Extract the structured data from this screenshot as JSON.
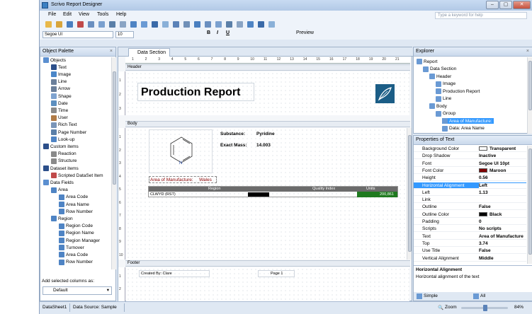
{
  "window": {
    "title": "Scrivo Report Designer"
  },
  "menu": [
    "File",
    "Edit",
    "View",
    "Tools",
    "Help"
  ],
  "help_placeholder": "Type a keyword for help",
  "toolbar": {
    "font": "Segoe UI",
    "size": "10",
    "bold": "B",
    "italic": "I",
    "underline": "U",
    "preview": "Preview"
  },
  "palette": {
    "title": "Object Palette",
    "items": [
      {
        "label": "Objects",
        "icon": "objects-icon",
        "color": "#5b8fd0"
      },
      {
        "label": "Text",
        "icon": "text-icon",
        "color": "#2c4f8a"
      },
      {
        "label": "Image",
        "icon": "image-icon",
        "color": "#4a86c8"
      },
      {
        "label": "Line",
        "icon": "line-icon",
        "color": "#6a7f9a"
      },
      {
        "label": "Arrow",
        "icon": "arrow-icon",
        "color": "#6a7f9a"
      },
      {
        "label": "Shape",
        "icon": "shape-icon",
        "color": "#7fa3cf"
      },
      {
        "label": "Date",
        "icon": "date-icon",
        "color": "#5c8fbf"
      },
      {
        "label": "Time",
        "icon": "time-icon",
        "color": "#8a8a8a"
      },
      {
        "label": "User",
        "icon": "user-icon",
        "color": "#b07b46"
      },
      {
        "label": "Rich Text",
        "icon": "rich-text-icon",
        "color": "#7a95b8"
      },
      {
        "label": "Page Number",
        "icon": "page-number-icon",
        "color": "#5a7fa8"
      },
      {
        "label": "Look-up",
        "icon": "lookup-icon",
        "color": "#4f84c4"
      },
      {
        "label": "Custom items",
        "icon": "custom-items-icon",
        "color": "#2c4f8a"
      },
      {
        "label": "Reaction",
        "icon": "reaction-icon",
        "color": "#8a8a8a"
      },
      {
        "label": "Structure",
        "icon": "structure-icon",
        "color": "#8a8a8a"
      },
      {
        "label": "Dataset items",
        "icon": "dataset-items-icon",
        "color": "#2c4f8a"
      },
      {
        "label": "Scripted DataSet Item",
        "icon": "scripted-dataset-icon",
        "color": "#c04a4a"
      },
      {
        "label": "Data Fields",
        "icon": "data-fields-icon",
        "color": "#5b8fd0"
      },
      {
        "label": "Area",
        "icon": "table-icon",
        "color": "#4f84c4"
      },
      {
        "label": "Area Code",
        "icon": "field-icon",
        "color": "#4f84c4"
      },
      {
        "label": "Area Name",
        "icon": "field-icon",
        "color": "#4f84c4"
      },
      {
        "label": "Row Number",
        "icon": "field-icon",
        "color": "#4f84c4"
      },
      {
        "label": "Region",
        "icon": "table-icon",
        "color": "#4f84c4"
      },
      {
        "label": "Region Code",
        "icon": "field-icon",
        "color": "#4f84c4"
      },
      {
        "label": "Region Name",
        "icon": "field-icon",
        "color": "#4f84c4"
      },
      {
        "label": "Region Manager",
        "icon": "field-icon",
        "color": "#4f84c4"
      },
      {
        "label": "Turnover",
        "icon": "field-icon",
        "color": "#4f84c4"
      },
      {
        "label": "Area Code",
        "icon": "field-icon",
        "color": "#4f84c4"
      },
      {
        "label": "Row Number",
        "icon": "field-icon",
        "color": "#4f84c4"
      }
    ],
    "columns_label": "Add selected columns as:",
    "columns_value": "Default"
  },
  "designer": {
    "tab": "Data Section",
    "header_label": "Header",
    "body_label": "Body",
    "footer_label": "Footer",
    "title": "Production Report",
    "substance_label": "Substance:",
    "substance_value": "Pyridine",
    "mass_label": "Exact Mass:",
    "mass_value": "14.003",
    "atom_label": "N",
    "area_label": "Area of Manufacture:",
    "area_value": "Wales",
    "table_headers": [
      "Region",
      "Quality Index",
      "Units"
    ],
    "table_row": {
      "region": "CLWYD (RST)",
      "units": "200,861"
    },
    "footer_left": "Created By: Clare",
    "footer_right": "Page 1",
    "ruler_top": [
      "1",
      "2",
      "3",
      "4",
      "5",
      "6",
      "7",
      "8",
      "9",
      "10",
      "11",
      "12",
      "13",
      "14",
      "15",
      "16",
      "17",
      "18",
      "19",
      "20",
      "21"
    ],
    "ruler_header": [
      "1",
      "2",
      "3"
    ],
    "ruler_body": [
      "1",
      "2",
      "3",
      "4",
      "5",
      "6",
      "7",
      "8",
      "9",
      "10"
    ],
    "ruler_footer": [
      "1",
      "2"
    ]
  },
  "explorer": {
    "title": "Explorer",
    "items": [
      "Report",
      "Data Section",
      "Header",
      "Image",
      "Production Report",
      "Line",
      "Body",
      "Group",
      "Area of Manufacture:",
      "Data: Area Name"
    ]
  },
  "properties": {
    "title": "Properties of Text",
    "rows": [
      {
        "k": "Background Color",
        "v": "Transparent",
        "sw": "#ffffff"
      },
      {
        "k": "Drop Shadow",
        "v": "Inactive"
      },
      {
        "k": "Font",
        "v": "Segoe UI 10pt"
      },
      {
        "k": "Font Color",
        "v": "Maroon",
        "sw": "#800000"
      },
      {
        "k": "Height",
        "v": "0.56"
      },
      {
        "k": "Horizontal Alignment",
        "v": "Left"
      },
      {
        "k": "Left",
        "v": "1.13"
      },
      {
        "k": "Link",
        "v": ""
      },
      {
        "k": "Outline",
        "v": "False"
      },
      {
        "k": "Outline Color",
        "v": "Black",
        "sw": "#000000"
      },
      {
        "k": "Padding",
        "v": "0"
      },
      {
        "k": "Scripts",
        "v": "No scripts"
      },
      {
        "k": "Text",
        "v": "Area of Manufacture"
      },
      {
        "k": "Top",
        "v": "3.74"
      },
      {
        "k": "Use Title",
        "v": "False"
      },
      {
        "k": "Vertical Alignment",
        "v": "Middle"
      }
    ],
    "desc_title": "Horizontal Alignment",
    "desc_text": "Horizontal alignment of the text",
    "tab_simple": "Simple",
    "tab_all": "All"
  },
  "status": {
    "sheet": "DataSheet1",
    "source": "Data Source: Sample",
    "zoom_label": "Zoom",
    "zoom": "84%"
  },
  "colors": {
    "accent": "#3399ff",
    "header_band": "#6b6b6b",
    "units_fill": "#1f7a1f"
  }
}
